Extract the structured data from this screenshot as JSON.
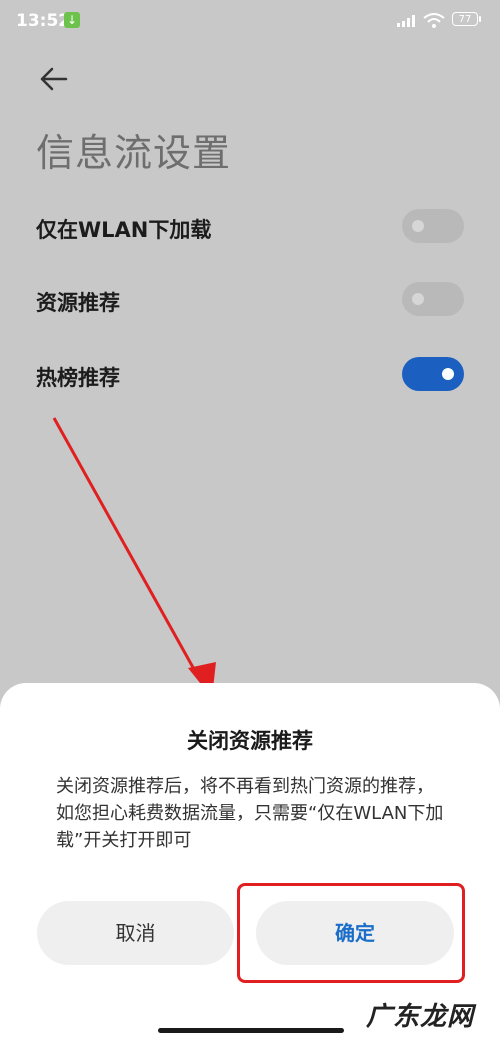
{
  "status_bar": {
    "time": "13:52",
    "battery": "77"
  },
  "page": {
    "title": "信息流设置"
  },
  "settings": [
    {
      "label": "仅在WLAN下加载",
      "enabled": false
    },
    {
      "label": "资源推荐",
      "enabled": false
    },
    {
      "label": "热榜推荐",
      "enabled": true
    }
  ],
  "dialog": {
    "title": "关闭资源推荐",
    "message": "关闭资源推荐后，将不再看到热门资源的推荐，如您担心耗费数据流量，只需要“仅在WLAN下加载”开关打开即可",
    "cancel_label": "取消",
    "confirm_label": "确定"
  },
  "watermark": "广东龙网",
  "colors": {
    "accent": "#1b5fc0",
    "annotation": "#e02020",
    "confirm_text": "#1a6ec8"
  }
}
